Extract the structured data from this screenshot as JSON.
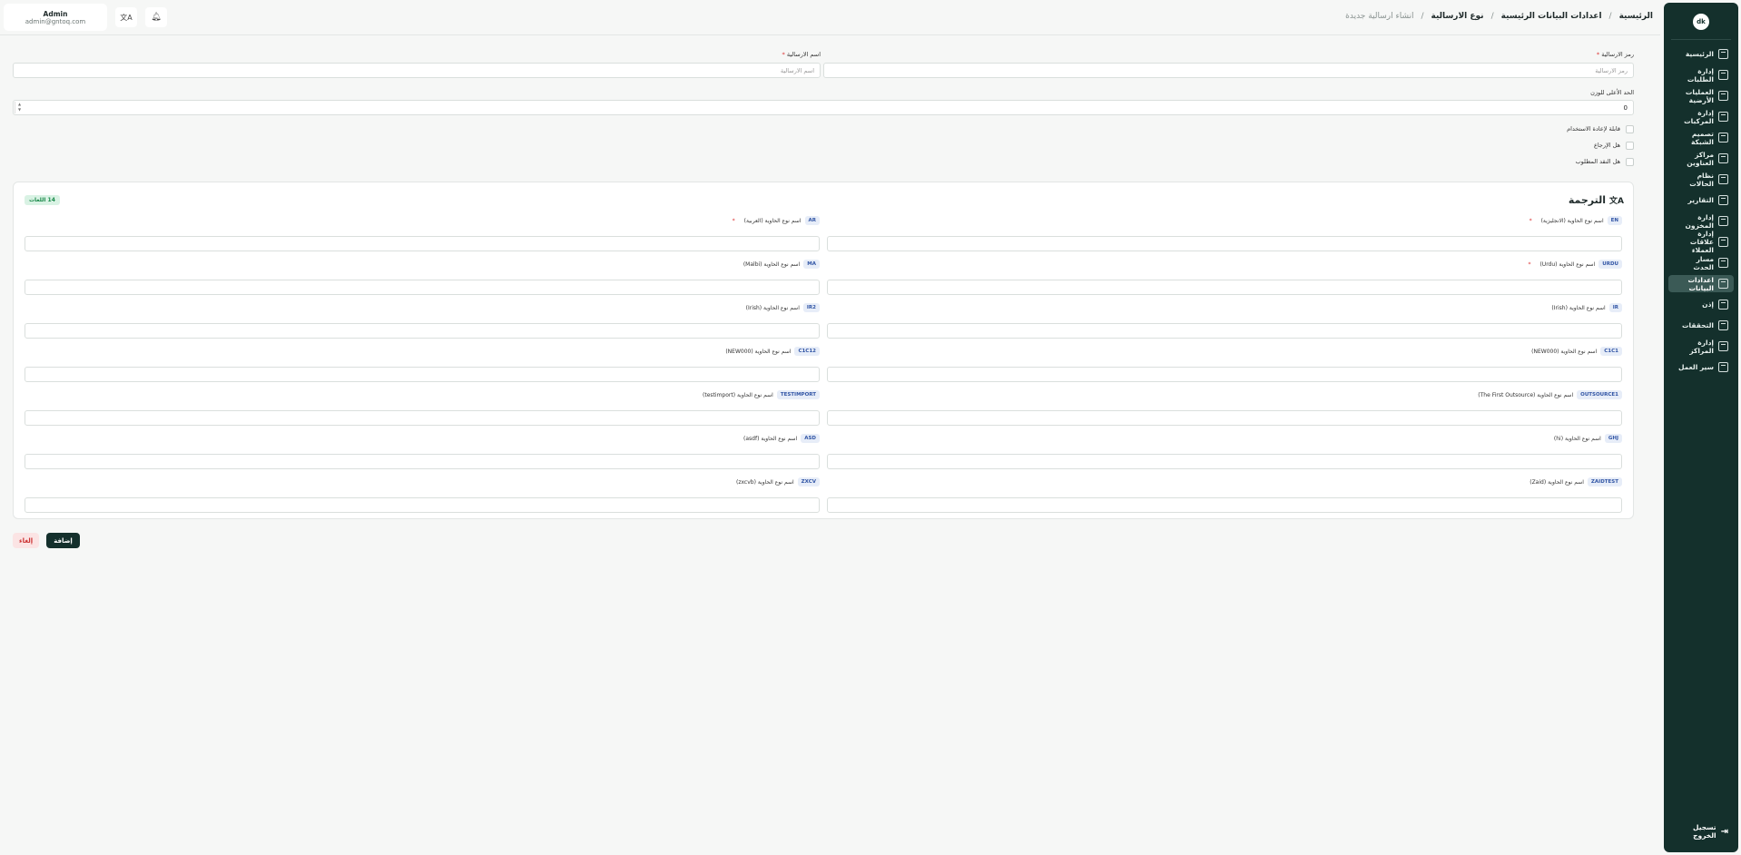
{
  "sidebar": {
    "logo": "dk",
    "items": [
      {
        "label": "الرئيسية",
        "icon": "dashboard-icon"
      },
      {
        "label": "إدارة الطلبات",
        "icon": "orders-icon"
      },
      {
        "label": "العمليات الأرضية",
        "icon": "operations-icon"
      },
      {
        "label": "إدارة المركبات",
        "icon": "truck-icon"
      },
      {
        "label": "تصميم الشبكة",
        "icon": "network-icon"
      },
      {
        "label": "مراكز العناوين",
        "icon": "location-icon"
      },
      {
        "label": "نظام الحالات",
        "icon": "status-icon"
      },
      {
        "label": "التقارير",
        "icon": "reports-icon"
      },
      {
        "label": "إدارة المخزون",
        "icon": "inventory-icon"
      },
      {
        "label": "إدارة علاقات العملاء",
        "icon": "crm-icon"
      },
      {
        "label": "مسار الحدث",
        "icon": "route-icon"
      },
      {
        "label": "اعدادات البيانات",
        "icon": "database-icon",
        "active": true
      },
      {
        "label": "إذن",
        "icon": "users-icon"
      },
      {
        "label": "التحققات",
        "icon": "verify-icon"
      },
      {
        "label": "إدارة المراكز",
        "icon": "centers-icon"
      },
      {
        "label": "سير العمل",
        "icon": "workflow-icon"
      }
    ],
    "logout": "تسجيل الخروج"
  },
  "header": {
    "breadcrumb": [
      "الرئيسية",
      "اعدادات البيانات الرئيسية",
      "نوع الارسالية",
      "انشاء ارسالية جديدة"
    ],
    "user_name": "Admin",
    "user_email": "admin@gntoq.com"
  },
  "form": {
    "code_label": "رمز الارسالية",
    "code_placeholder": "رمز الارسالية",
    "name_label": "اسم الارسالية",
    "name_placeholder": "اسم الارسالية",
    "weight_label": "الحد الأعلى للوزن",
    "weight_value": "0",
    "checks": [
      "قابلة لإعادة الاستخدام",
      "هل الإرجاع",
      "هل النقد المطلوب"
    ]
  },
  "translation": {
    "title": "الترجمة",
    "count": "14 اللغات",
    "fields": [
      {
        "tag": "EN",
        "label": "اسم نوع الحاوية (الانجليزية)",
        "required": true
      },
      {
        "tag": "AR",
        "label": "اسم نوع الحاوية (العربية)",
        "required": true
      },
      {
        "tag": "URDU",
        "label": "اسم نوع الحاوية (Urdu)",
        "required": true
      },
      {
        "tag": "MA",
        "label": "اسم نوع الحاوية (Malbi)",
        "required": false
      },
      {
        "tag": "IR",
        "label": "اسم نوع الحاوية (Irish)",
        "required": false
      },
      {
        "tag": "IR2",
        "label": "اسم نوع الحاوية (Irish)",
        "required": false
      },
      {
        "tag": "C1C1",
        "label": "اسم نوع الحاوية (NEW000)",
        "required": false
      },
      {
        "tag": "C1C12",
        "label": "اسم نوع الحاوية (NEW000)",
        "required": false
      },
      {
        "tag": "OUTSOURCE1",
        "label": "اسم نوع الحاوية (The First Outsource)",
        "required": false
      },
      {
        "tag": "TESTIMPORT",
        "label": "اسم نوع الحاوية (testimport)",
        "required": false
      },
      {
        "tag": "GHJ",
        "label": "اسم نوع الحاوية (hi)",
        "required": false
      },
      {
        "tag": "ASD",
        "label": "اسم نوع الحاوية (asdf)",
        "required": false
      },
      {
        "tag": "ZAIDTEST",
        "label": "اسم نوع الحاوية (Zaid)",
        "required": false
      },
      {
        "tag": "ZXCV",
        "label": "اسم نوع الحاوية (zxcvb)",
        "required": false
      }
    ]
  },
  "actions": {
    "add": "إضافة",
    "cancel": "إلغاء"
  }
}
